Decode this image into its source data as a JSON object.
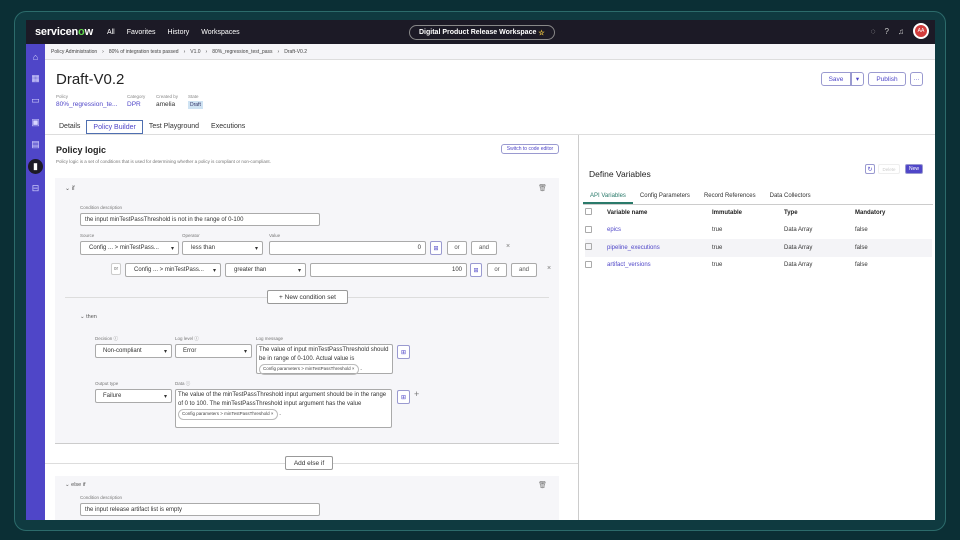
{
  "topbar": {
    "brand_a": "servicen",
    "brand_o": "o",
    "brand_b": "w",
    "nav": [
      "All",
      "Favorites",
      "History",
      "Workspaces"
    ],
    "workspace": "Digital Product Release Workspace",
    "avatar": "AA"
  },
  "breadcrumb": [
    "Policy Administration",
    "80% of integration tests passed",
    "V1.0",
    "80%_regression_test_pass",
    "Draft-V0.2"
  ],
  "header": {
    "title": "Draft-V0.2",
    "policy_label": "Policy",
    "policy_value": "80%_regression_te...",
    "category_label": "Category",
    "category_value": "DPR",
    "created_label": "Created by",
    "created_value": "amelia",
    "state_label": "State",
    "state_value": "Draft",
    "save": "Save",
    "publish": "Publish",
    "more": "···"
  },
  "tabs": [
    "Details",
    "Policy Builder",
    "Test Playground",
    "Executions"
  ],
  "logic": {
    "title": "Policy logic",
    "desc": "Policy logic is a set of conditions that is used for determining whether a policy is compliant or non-compliant.",
    "switch": "Switch to code editor",
    "if_label": "if",
    "cond_desc_label": "Condition description",
    "cond_desc": "the input minTestPassThreshold is not in the range of 0-100",
    "source_label": "Source",
    "operator_label": "Operator",
    "value_label": "Value",
    "row1": {
      "source": "Config ... > minTestPass...",
      "operator": "less than",
      "value": "0"
    },
    "row2": {
      "prefix": "or",
      "source": "Config ... > minTestPass...",
      "operator": "greater than",
      "value": "100"
    },
    "or": "or",
    "and": "and",
    "new_set": "+ New condition set",
    "then_label": "then",
    "decision_label": "Decision ⓘ",
    "decision": "Non-compliant",
    "loglevel_label": "Log level ⓘ",
    "loglevel": "Error",
    "logmsg_label": "Log message",
    "logmsg": "The value of input minTestPassThreshold should be in range of 0-100. Actual value is",
    "chip": "Config parameters > minTestPassThreshold",
    "output_label": "Output type",
    "output": "Failure",
    "data_label": "Data ⓘ",
    "data": "The value of the minTestPassThreshold input argument should be in the range of 0 to 100. The minTestPassThreshold input argument has the value",
    "add_else": "Add else if",
    "elseif_label": "else if",
    "cond2_desc": "the input release artifact list is empty"
  },
  "vars": {
    "title": "Define Variables",
    "delete": "Delete",
    "new": "New",
    "tabs": [
      "API Variables",
      "Config Parameters",
      "Record References",
      "Data Collectors"
    ],
    "headers": [
      "Variable name",
      "Immutable",
      "Type",
      "Mandatory"
    ],
    "rows": [
      [
        "epics",
        "true",
        "Data Array",
        "false"
      ],
      [
        "pipeline_executions",
        "true",
        "Data Array",
        "false"
      ],
      [
        "artifact_versions",
        "true",
        "Data Array",
        "false"
      ]
    ]
  },
  "colors": {
    "accent": "#4f46c8",
    "topbar": "#1c1a26"
  }
}
